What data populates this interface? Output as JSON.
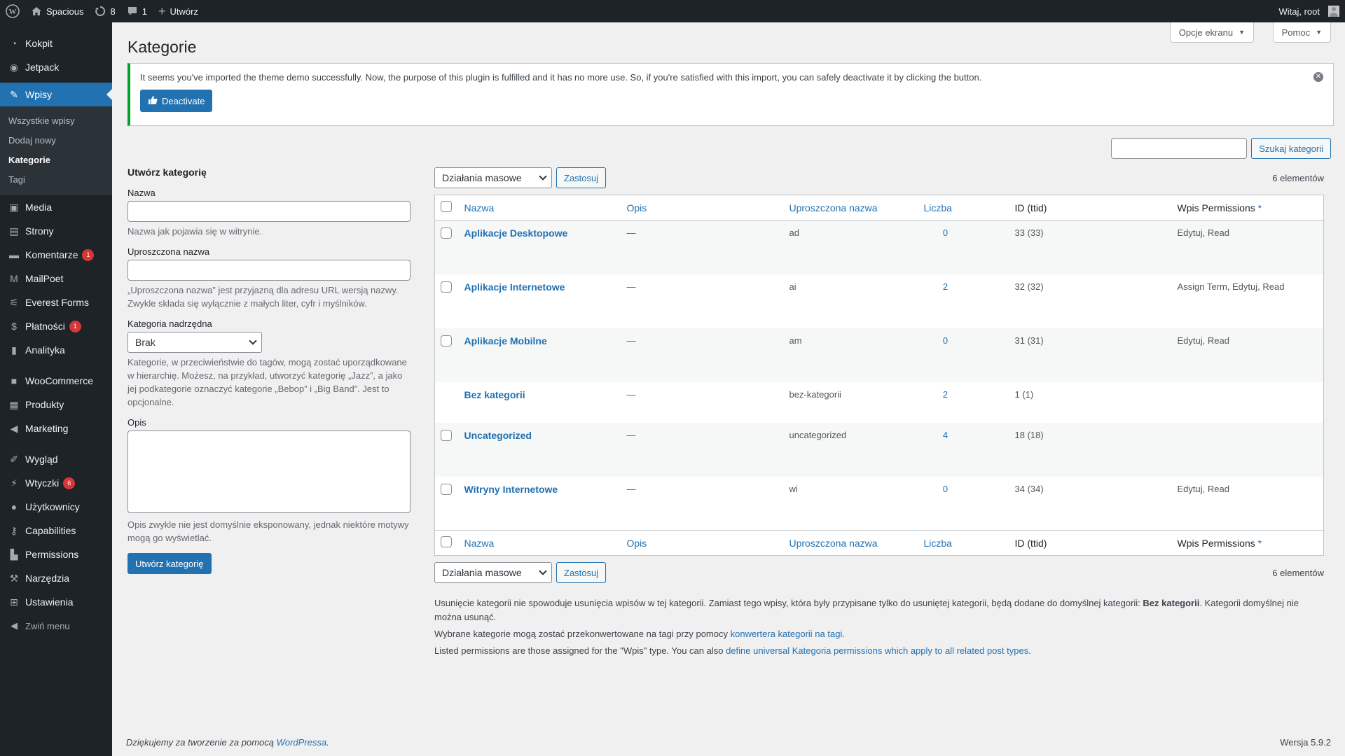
{
  "adminbar": {
    "site_name": "Spacious",
    "updates_count": "8",
    "comments_count": "1",
    "new_label": "Utwórz",
    "greeting": "Witaj, root"
  },
  "sidebar": {
    "items": [
      {
        "label": "Kokpit",
        "icon": "dashboard-icon"
      },
      {
        "label": "Jetpack",
        "icon": "jetpack-icon"
      },
      {
        "label": "Wpisy",
        "icon": "pin-icon"
      },
      {
        "label": "Media",
        "icon": "media-icon"
      },
      {
        "label": "Strony",
        "icon": "page-icon"
      },
      {
        "label": "Komentarze",
        "icon": "comment-icon",
        "badge": "1"
      },
      {
        "label": "MailPoet",
        "icon": "mailpoet-icon"
      },
      {
        "label": "Everest Forms",
        "icon": "forms-icon"
      },
      {
        "label": "Płatności",
        "icon": "payment-icon",
        "badge": "1"
      },
      {
        "label": "Analityka",
        "icon": "chart-icon"
      },
      {
        "label": "WooCommerce",
        "icon": "woo-icon"
      },
      {
        "label": "Produkty",
        "icon": "archive-icon"
      },
      {
        "label": "Marketing",
        "icon": "megaphone-icon"
      },
      {
        "label": "Wygląd",
        "icon": "brush-icon"
      },
      {
        "label": "Wtyczki",
        "icon": "plugin-icon",
        "badge": "6"
      },
      {
        "label": "Użytkownicy",
        "icon": "users-icon"
      },
      {
        "label": "Capabilities",
        "icon": "wrench-icon"
      },
      {
        "label": "Permissions",
        "icon": "lock-icon"
      },
      {
        "label": "Narzędzia",
        "icon": "tools-icon"
      },
      {
        "label": "Ustawienia",
        "icon": "settings-icon"
      },
      {
        "label": "Zwiń menu",
        "icon": "collapse-icon"
      }
    ],
    "submenu": [
      "Wszystkie wpisy",
      "Dodaj nowy",
      "Kategorie",
      "Tagi"
    ]
  },
  "header": {
    "title": "Kategorie",
    "screen_options": "Opcje ekranu",
    "help": "Pomoc"
  },
  "notice": {
    "text": "It seems you've imported the theme demo successfully. Now, the purpose of this plugin is fulfilled and it has no more use. So, if you're satisfied with this import, you can safely deactivate it by clicking the button.",
    "button": "Deactivate"
  },
  "search": {
    "button": "Szukaj kategorii",
    "value": ""
  },
  "form": {
    "heading": "Utwórz kategorię",
    "name_label": "Nazwa",
    "name_help": "Nazwa jak pojawia się w witrynie.",
    "slug_label": "Uproszczona nazwa",
    "slug_help": "„Uproszczona nazwa” jest przyjazną dla adresu URL wersją nazwy. Zwykle składa się wyłącznie z małych liter, cyfr i myślników.",
    "parent_label": "Kategoria nadrzędna",
    "parent_value": "Brak",
    "parent_help": "Kategorie, w przeciwieństwie do tagów, mogą zostać uporządkowane w hierarchię. Możesz, na przykład, utworzyć kategorię „Jazz”, a jako jej podkategorie oznaczyć kategorie „Bebop” i „Big Band”. Jest to opcjonalne.",
    "desc_label": "Opis",
    "desc_help": "Opis zwykle nie jest domyślnie eksponowany, jednak niektóre motywy mogą go wyświetlać.",
    "submit": "Utwórz kategorię"
  },
  "list": {
    "bulk_action": "Działania masowe",
    "apply": "Zastosuj",
    "count": "6 elementów",
    "columns": [
      "Nazwa",
      "Opis",
      "Uproszczona nazwa",
      "Liczba",
      "ID (ttid)",
      "Wpis Permissions",
      "*"
    ],
    "rows": [
      {
        "name": "Aplikacje Desktopowe",
        "desc": "—",
        "slug": "ad",
        "count": "0",
        "id": "33 (33)",
        "perms": "Edytuj, Read"
      },
      {
        "name": "Aplikacje Internetowe",
        "desc": "—",
        "slug": "ai",
        "count": "2",
        "id": "32 (32)",
        "perms": "Assign Term, Edytuj, Read"
      },
      {
        "name": "Aplikacje Mobilne",
        "desc": "—",
        "slug": "am",
        "count": "0",
        "id": "31 (31)",
        "perms": "Edytuj, Read"
      },
      {
        "name": "Bez kategorii",
        "desc": "—",
        "slug": "bez-kategorii",
        "count": "2",
        "id": "1 (1)",
        "perms": ""
      },
      {
        "name": "Uncategorized",
        "desc": "—",
        "slug": "uncategorized",
        "count": "4",
        "id": "18 (18)",
        "perms": ""
      },
      {
        "name": "Witryny Internetowe",
        "desc": "—",
        "slug": "wi",
        "count": "0",
        "id": "34 (34)",
        "perms": "Edytuj, Read"
      }
    ]
  },
  "help": {
    "p1_a": "Usunięcie kategorii nie spowoduje usunięcia wpisów w tej kategorii. Zamiast tego wpisy, która były przypisane tylko do usuniętej kategorii, będą dodane do domyślnej kategorii: ",
    "p1_b": "Bez kategorii",
    "p1_c": ". Kategorii domyślnej nie można usunąć.",
    "p2_a": "Wybrane kategorie mogą zostać przekonwertowane na tagi przy pomocy ",
    "p2_link": "konwertera kategorii na tagi",
    "p2_c": ".",
    "p3_a": "Listed permissions are those assigned for the \"Wpis\" type. You can also ",
    "p3_link": "define universal Kategoria permissions which apply to all related post types",
    "p3_c": "."
  },
  "footer": {
    "thanks": "Dziękujemy za tworzenie za pomocą ",
    "wp_link": "WordPressa",
    "thanks_end": ".",
    "version": "Wersja 5.9.2"
  }
}
